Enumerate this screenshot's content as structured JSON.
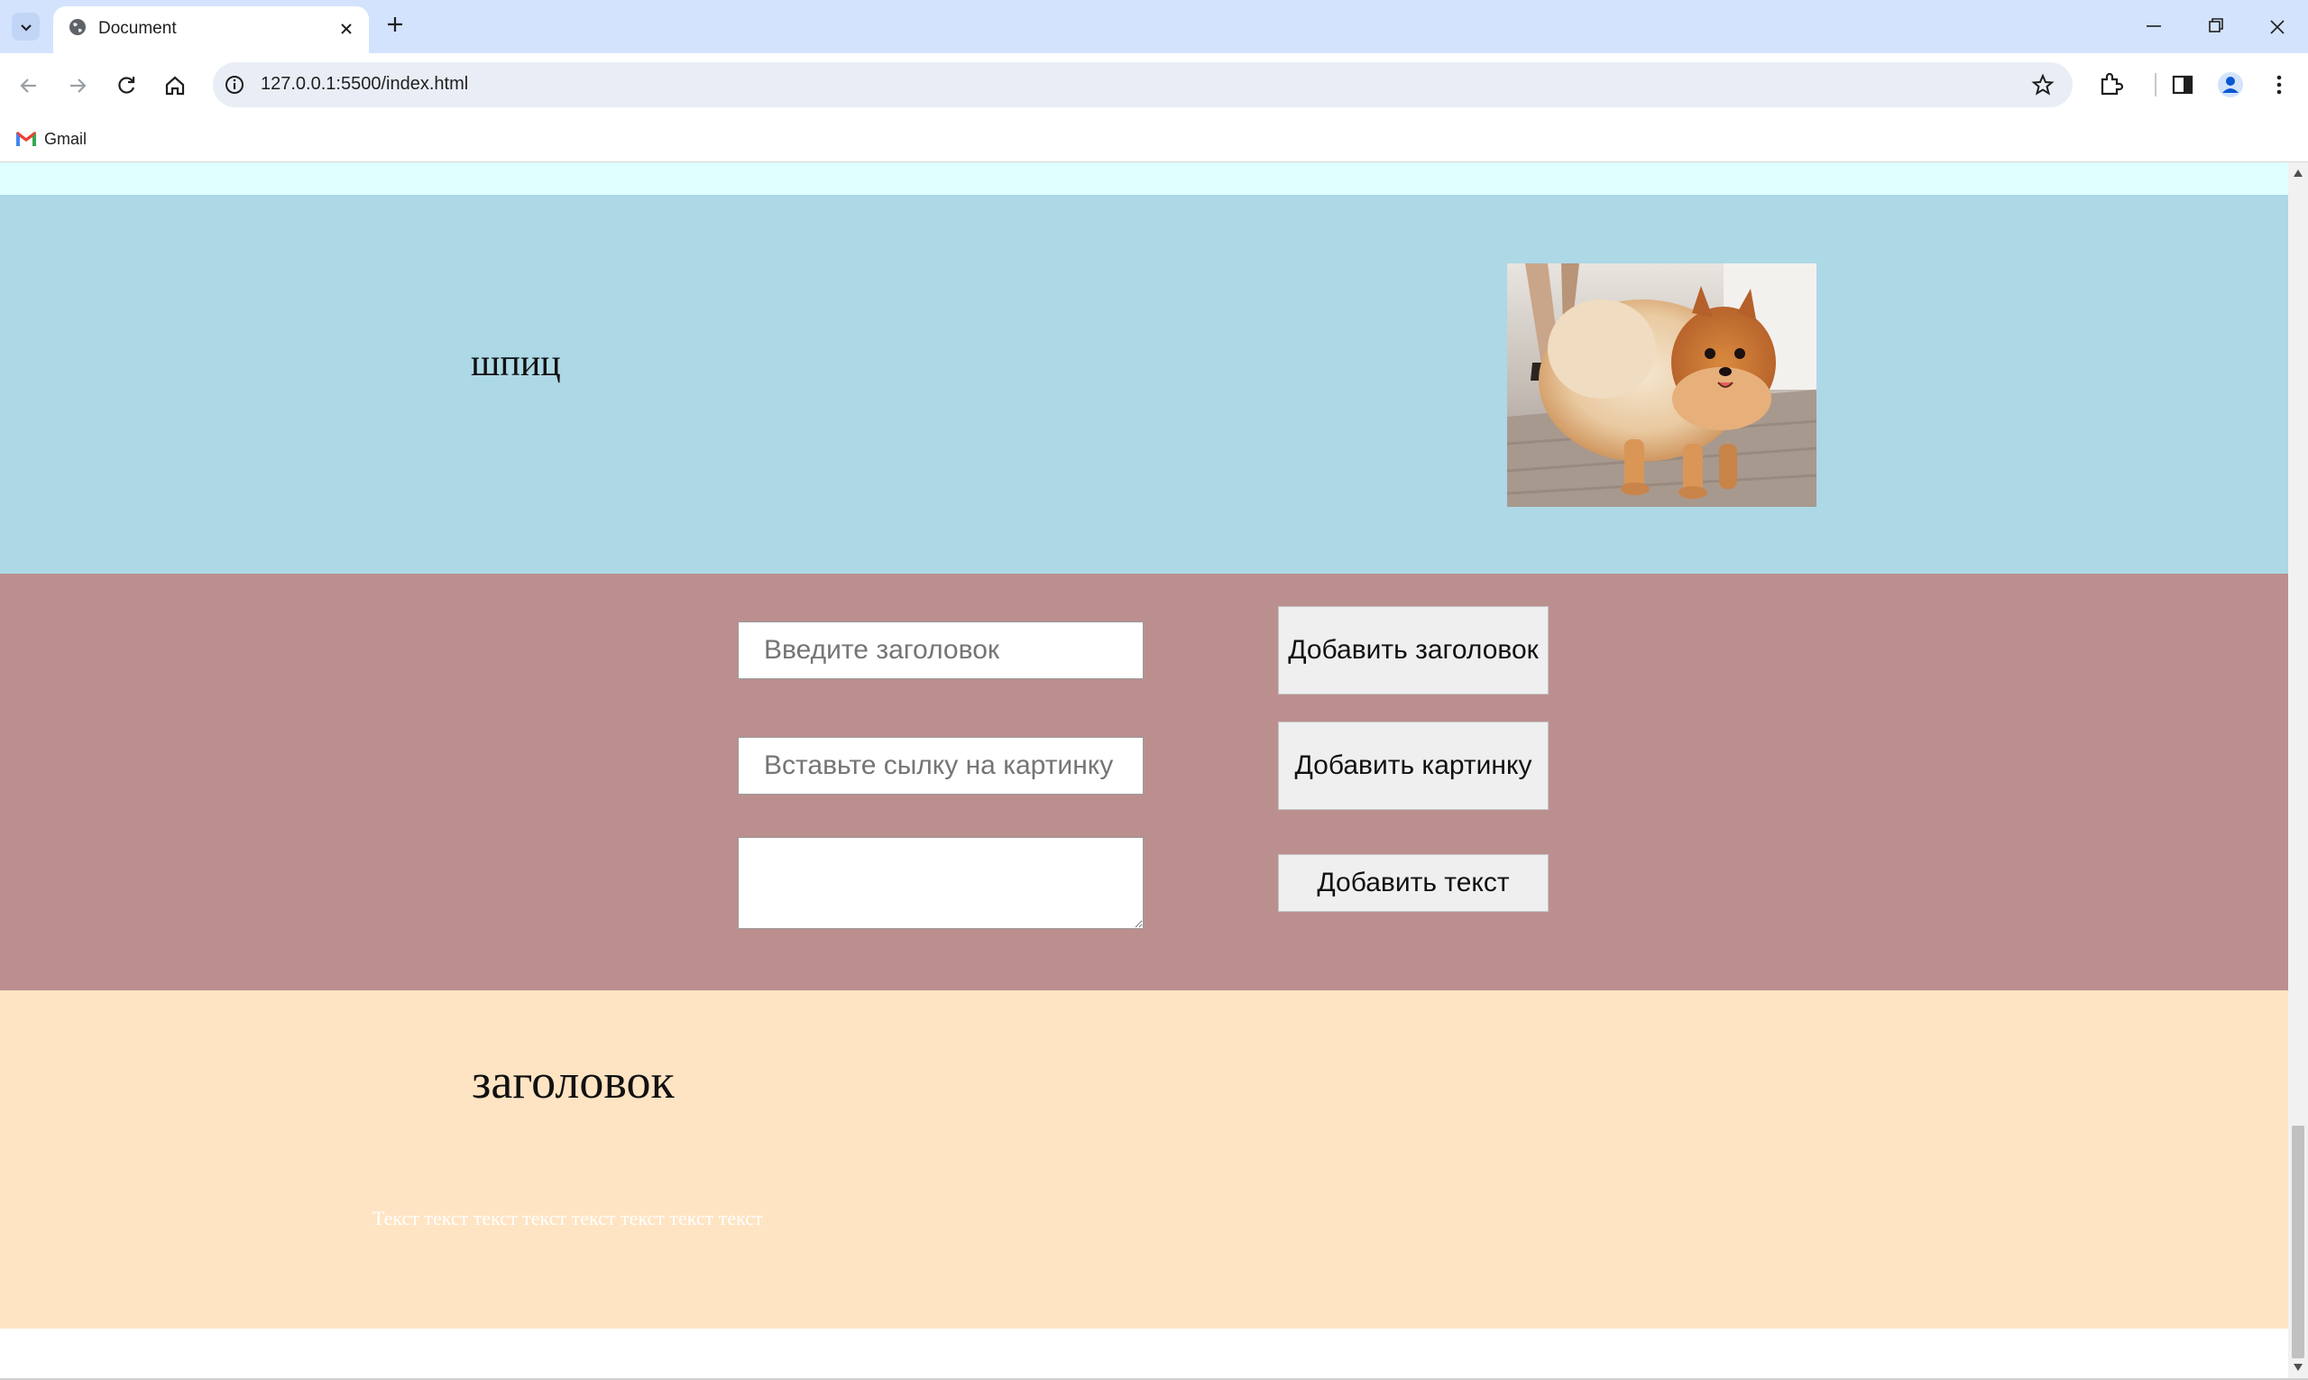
{
  "browser": {
    "tab_title": "Document",
    "url": "127.0.0.1:5500/index.html",
    "bookmarks": [
      {
        "label": "Gmail",
        "icon": "gmail-icon"
      }
    ],
    "accent_color": "#d3e3fd"
  },
  "page": {
    "card": {
      "title": "шпиц",
      "image_alt": "pomeranian-dog-photo",
      "background": "#add8e6"
    },
    "form": {
      "title_input_placeholder": "Введите заголовок",
      "image_input_placeholder": "Вставьте сылку на картинку",
      "text_area_value": "",
      "add_title_button": "Добавить заголовок",
      "add_image_button": "Добавить картинку",
      "add_text_button": "Добавить текст",
      "background": "#bc8f8f"
    },
    "article": {
      "title": "заголовок",
      "text": "Текст текст текст текст текст текст текст текст",
      "background": "#ffe4c4"
    }
  }
}
